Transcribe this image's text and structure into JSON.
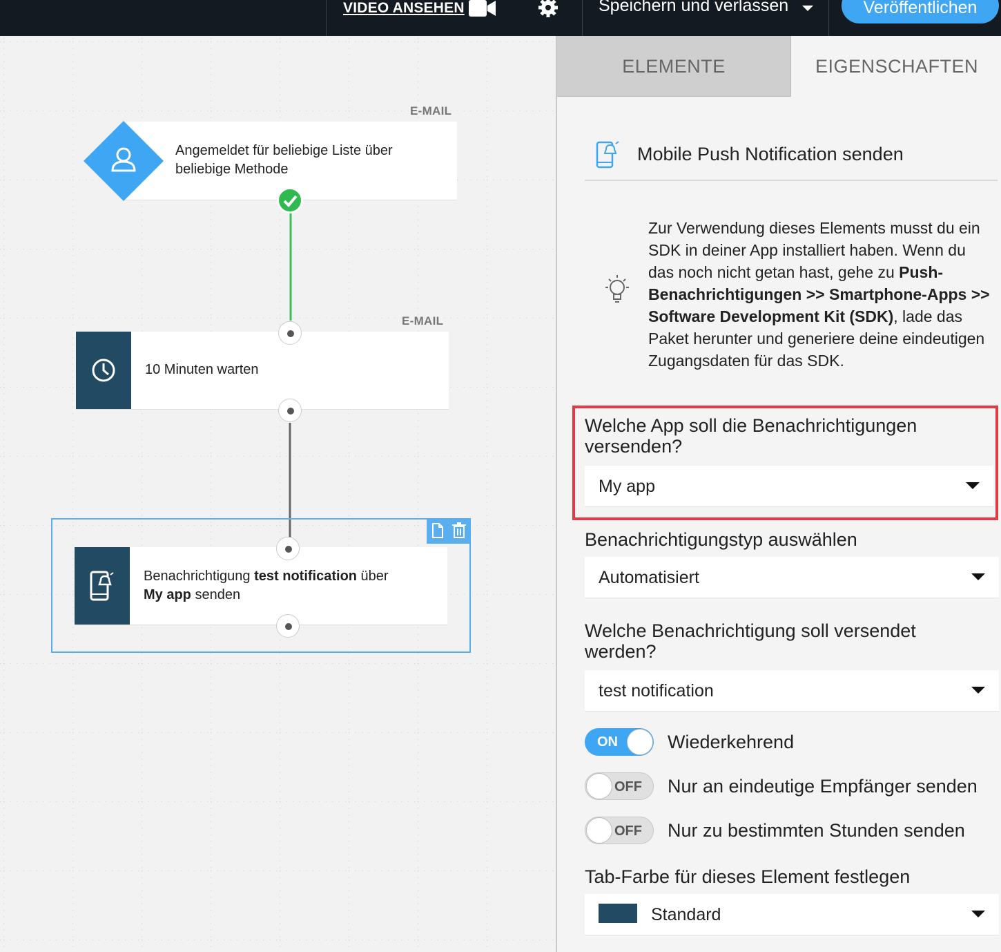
{
  "topbar": {
    "video_link": "VIDEO ANSEHEN",
    "save_menu": "Speichern und verlassen",
    "publish": "Veröffentlichen"
  },
  "canvas": {
    "node_trigger": {
      "label": "E-MAIL",
      "text": "Angemeldet für beliebige Liste über beliebige Methode"
    },
    "node_wait": {
      "label": "E-MAIL",
      "text": "10 Minuten warten"
    },
    "node_push": {
      "text_prefix": "Benachrichtigung ",
      "notification_name": "test notification",
      "text_mid": " über",
      "app_name": "My app",
      "text_suffix": " senden"
    }
  },
  "panel": {
    "tabs": {
      "elements": "ELEMENTE",
      "properties": "EIGENSCHAFTEN"
    },
    "title": "Mobile Push Notification senden",
    "info": {
      "part1": "Zur Verwendung dieses Elements musst du ein SDK in deiner App installiert haben. Wenn du das noch nicht getan hast, gehe zu ",
      "bold": "Push-Benachrichtigungen >> Smartphone-Apps >> Software Development Kit (SDK)",
      "part2": ", lade das Paket herunter und generiere deine eindeutigen Zugangsdaten für das SDK."
    },
    "app_question": "Welche App soll die Benachrichtigungen versenden?",
    "app_value": "My app",
    "type_label": "Benachrichtigungstyp auswählen",
    "type_value": "Automatisiert",
    "notification_question": "Welche Benachrichtigung soll versendet werden?",
    "notification_value": "test notification",
    "toggles": [
      {
        "state": "ON",
        "label": "Wiederkehrend"
      },
      {
        "state": "OFF",
        "label": "Nur an eindeutige Empfänger senden"
      },
      {
        "state": "OFF",
        "label": "Nur zu bestimmten Stunden senden"
      }
    ],
    "color_label": "Tab-Farbe für dieses Element festlegen",
    "color_value": "Standard"
  },
  "colors": {
    "accent": "#3fa6f3",
    "node_icon": "#224b63",
    "success": "#30b94f",
    "highlight": "#e03a43",
    "topbar": "#131a22"
  }
}
